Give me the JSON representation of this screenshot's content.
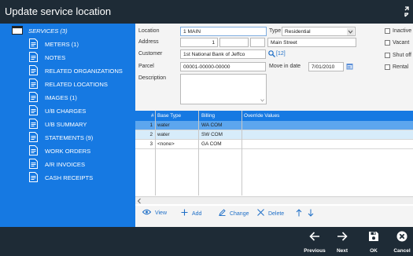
{
  "window": {
    "title": "Update service location"
  },
  "sidebar": {
    "header": "SERVICES (3)",
    "items": [
      {
        "label": "METERS (1)",
        "icon": "document-icon"
      },
      {
        "label": "NOTES",
        "icon": "document-icon"
      },
      {
        "label": "RELATED ORGANIZATIONS",
        "icon": "document-icon"
      },
      {
        "label": "RELATED LOCATIONS",
        "icon": "document-icon"
      },
      {
        "label": "IMAGES (1)",
        "icon": "document-icon"
      },
      {
        "label": "U/B CHARGES",
        "icon": "document-icon"
      },
      {
        "label": "U/B SUMMARY",
        "icon": "document-icon"
      },
      {
        "label": "STATEMENTS (9)",
        "icon": "document-icon"
      },
      {
        "label": "WORK ORDERS",
        "icon": "document-icon"
      },
      {
        "label": "A/R INVOICES",
        "icon": "document-icon"
      },
      {
        "label": "CASH RECEIPTS",
        "icon": "document-icon"
      }
    ]
  },
  "form": {
    "location_label": "Location",
    "location_value": "1 MAIN",
    "type_label": "Type",
    "type_value": "Residential",
    "address_label": "Address",
    "address_number": "1",
    "address_street": "Main Street",
    "customer_label": "Customer",
    "customer_value": "1st National Bank of Jeffco",
    "customer_link": "[12]",
    "parcel_label": "Parcel",
    "parcel_value": "00001-00000-00000",
    "move_in_label": "Move in date",
    "move_in_value": "7/01/2010",
    "description_label": "Description",
    "checkboxes": [
      "Inactive",
      "Vacant",
      "Shut off",
      "Rental"
    ]
  },
  "grid": {
    "columns": {
      "num": "#",
      "base_type": "Base Type",
      "billing": "Billing",
      "override": "Override Values"
    },
    "rows": [
      {
        "num": "1",
        "base_type": "water",
        "billing": "WA COM",
        "override": ""
      },
      {
        "num": "2",
        "base_type": "water",
        "billing": "SW COM",
        "override": ""
      },
      {
        "num": "3",
        "base_type": "<none>",
        "billing": "GA COM",
        "override": ""
      }
    ]
  },
  "toolbar": {
    "view": "View",
    "add": "Add",
    "change": "Change",
    "delete": "Delete"
  },
  "footer": {
    "previous": "Previous",
    "next": "Next",
    "ok": "OK",
    "cancel": "Cancel"
  },
  "colors": {
    "accent": "#1679e2",
    "dark": "#1e2b36",
    "row_selected": "#5da6ee",
    "row_alt": "#d7ecfa"
  }
}
